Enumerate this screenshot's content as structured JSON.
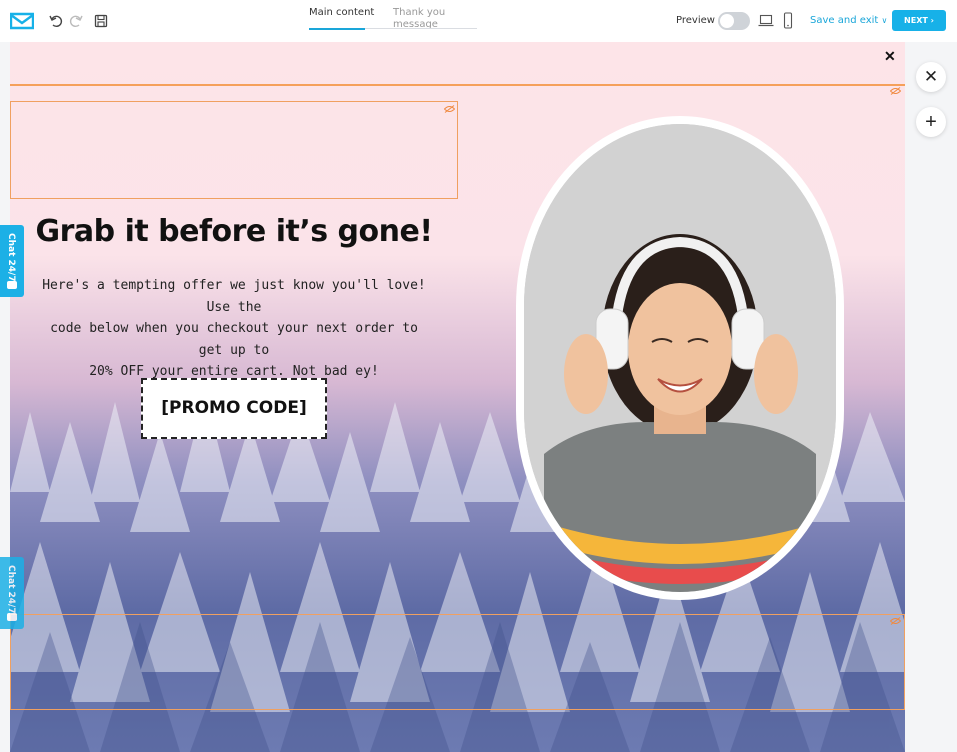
{
  "toolbar": {
    "logo_icon": "envelope-logo-icon",
    "undo_icon": "undo-icon",
    "redo_icon": "redo-icon",
    "save_icon": "save-icon",
    "tabs": [
      {
        "label": "Main content",
        "active": true
      },
      {
        "label": "Thank you message",
        "active": false
      }
    ],
    "preview_label": "Preview",
    "preview_enabled": false,
    "desktop_icon": "laptop-icon",
    "mobile_icon": "mobile-icon",
    "save_exit_label": "Save and exit",
    "next_label": "NEXT"
  },
  "popup": {
    "close_glyph": "✕",
    "headline": "Grab it before it’s gone!",
    "body_lines": [
      "Here's a tempting offer we just know you'll love! Use the",
      "code below when you checkout your next order to get up to",
      "20% OFF your entire cart. Not bad ey!"
    ],
    "promo_code": "[PROMO CODE]"
  },
  "side": {
    "chat_label": "Chat 24/7",
    "close_glyph": "✕",
    "add_glyph": "+"
  },
  "colors": {
    "accent": "#17b1e8",
    "guide_orange": "#f5a05a",
    "tab_underline": "#1aa6d9"
  }
}
